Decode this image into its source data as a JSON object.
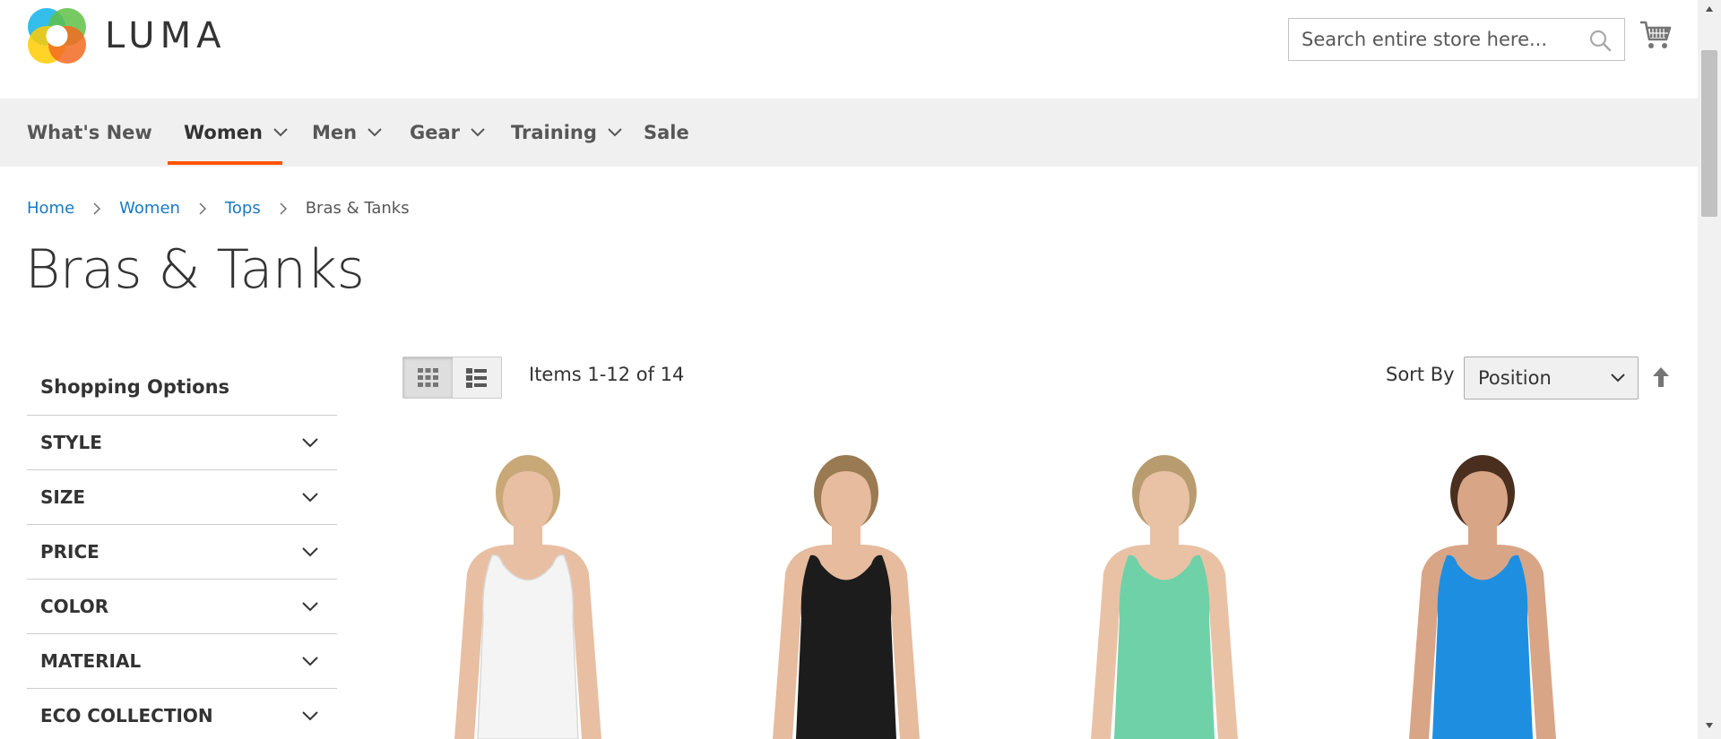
{
  "header": {
    "logo_text": "LUMA",
    "search_placeholder": "Search entire store here..."
  },
  "nav": {
    "items": [
      {
        "label": "What's New",
        "has_dropdown": false
      },
      {
        "label": "Women",
        "has_dropdown": true,
        "active": true
      },
      {
        "label": "Men",
        "has_dropdown": true
      },
      {
        "label": "Gear",
        "has_dropdown": true
      },
      {
        "label": "Training",
        "has_dropdown": true
      },
      {
        "label": "Sale",
        "has_dropdown": false
      }
    ]
  },
  "breadcrumb": {
    "items": [
      "Home",
      "Women",
      "Tops"
    ],
    "current": "Bras & Tanks"
  },
  "page_title": "Bras & Tanks",
  "sidebar": {
    "title": "Shopping Options",
    "filters": [
      "STYLE",
      "SIZE",
      "PRICE",
      "COLOR",
      "MATERIAL",
      "ECO COLLECTION"
    ]
  },
  "toolbar": {
    "items_count": "Items 1-12 of 14",
    "sort_label": "Sort By",
    "sort_value": "Position",
    "view_mode": "grid"
  },
  "products": [
    {
      "top_color": "#f4f4f4",
      "skin": "#e8bfa3",
      "hair": "#c9a877"
    },
    {
      "top_color": "#1c1c1c",
      "skin": "#e6bb9e",
      "hair": "#9a7a52"
    },
    {
      "top_color": "#6fd1a8",
      "skin": "#e9c2a6",
      "hair": "#b89c70"
    },
    {
      "top_color": "#1e8fe0",
      "skin": "#d9a587",
      "hair": "#4a2f1f"
    }
  ],
  "colors": {
    "accent": "#ff5501",
    "link": "#1979c3",
    "nav_bg": "#f0f0f0"
  }
}
